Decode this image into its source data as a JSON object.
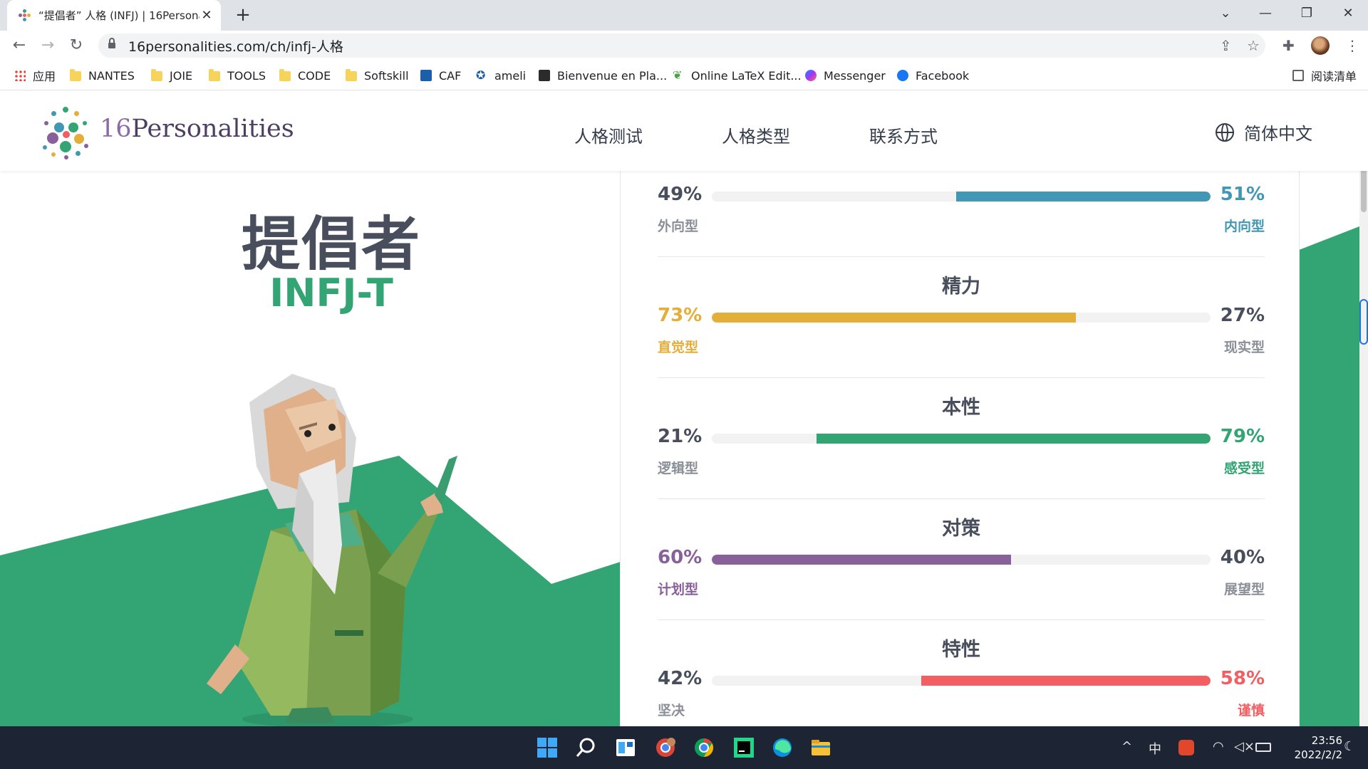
{
  "browser": {
    "tab_title": "“提倡者” 人格 (INFJ) | 16Personalities",
    "url": "16personalities.com/ch/infj-人格",
    "bookmarks": [
      {
        "label": "应用",
        "icon": "apps-grid-icon"
      },
      {
        "label": "NANTES",
        "icon": "folder-icon"
      },
      {
        "label": "JOIE",
        "icon": "folder-icon"
      },
      {
        "label": "TOOLS",
        "icon": "folder-icon"
      },
      {
        "label": "CODE",
        "icon": "folder-icon"
      },
      {
        "label": "Softskill",
        "icon": "folder-icon"
      },
      {
        "label": "CAF",
        "icon": "caf-icon"
      },
      {
        "label": "ameli",
        "icon": "ameli-icon"
      },
      {
        "label": "Bienvenue en Pla...",
        "icon": "site-icon"
      },
      {
        "label": "Online LaTeX Edit...",
        "icon": "overleaf-icon"
      },
      {
        "label": "Messenger",
        "icon": "messenger-icon"
      },
      {
        "label": "Facebook",
        "icon": "facebook-icon"
      }
    ],
    "reading_list": "阅读清单"
  },
  "site": {
    "brand": "Personalities",
    "brand_num": "16",
    "nav": [
      "人格测试",
      "人格类型",
      "联系方式"
    ],
    "language": "简体中文"
  },
  "hero": {
    "title": "提倡者",
    "code": "INFJ-T"
  },
  "colors": {
    "accent_green": "#33a474",
    "energy_yellow": "#e4ae3a",
    "mind_blue": "#4298b4",
    "tactics_purple": "#88619a",
    "identity_red": "#f25e62"
  },
  "traits": [
    {
      "name": "",
      "left_pct": "49%",
      "right_pct": "51%",
      "left_label": "外向型",
      "right_label": "内向型",
      "dominant": "right",
      "fill": 0.51,
      "color": "#4298b4"
    },
    {
      "name": "精力",
      "left_pct": "73%",
      "right_pct": "27%",
      "left_label": "直觉型",
      "right_label": "现实型",
      "dominant": "left",
      "fill": 0.73,
      "color": "#e4ae3a"
    },
    {
      "name": "本性",
      "left_pct": "21%",
      "right_pct": "79%",
      "left_label": "逻辑型",
      "right_label": "感受型",
      "dominant": "right",
      "fill": 0.79,
      "color": "#33a474"
    },
    {
      "name": "对策",
      "left_pct": "60%",
      "right_pct": "40%",
      "left_label": "计划型",
      "right_label": "展望型",
      "dominant": "left",
      "fill": 0.6,
      "color": "#88619a"
    },
    {
      "name": "特性",
      "left_pct": "42%",
      "right_pct": "58%",
      "left_label": "坚决",
      "right_label": "谨慎",
      "dominant": "right",
      "fill": 0.58,
      "color": "#f25e62"
    }
  ],
  "taskbar": {
    "ime": "中",
    "time": "23:56",
    "date": "2022/2/2"
  }
}
